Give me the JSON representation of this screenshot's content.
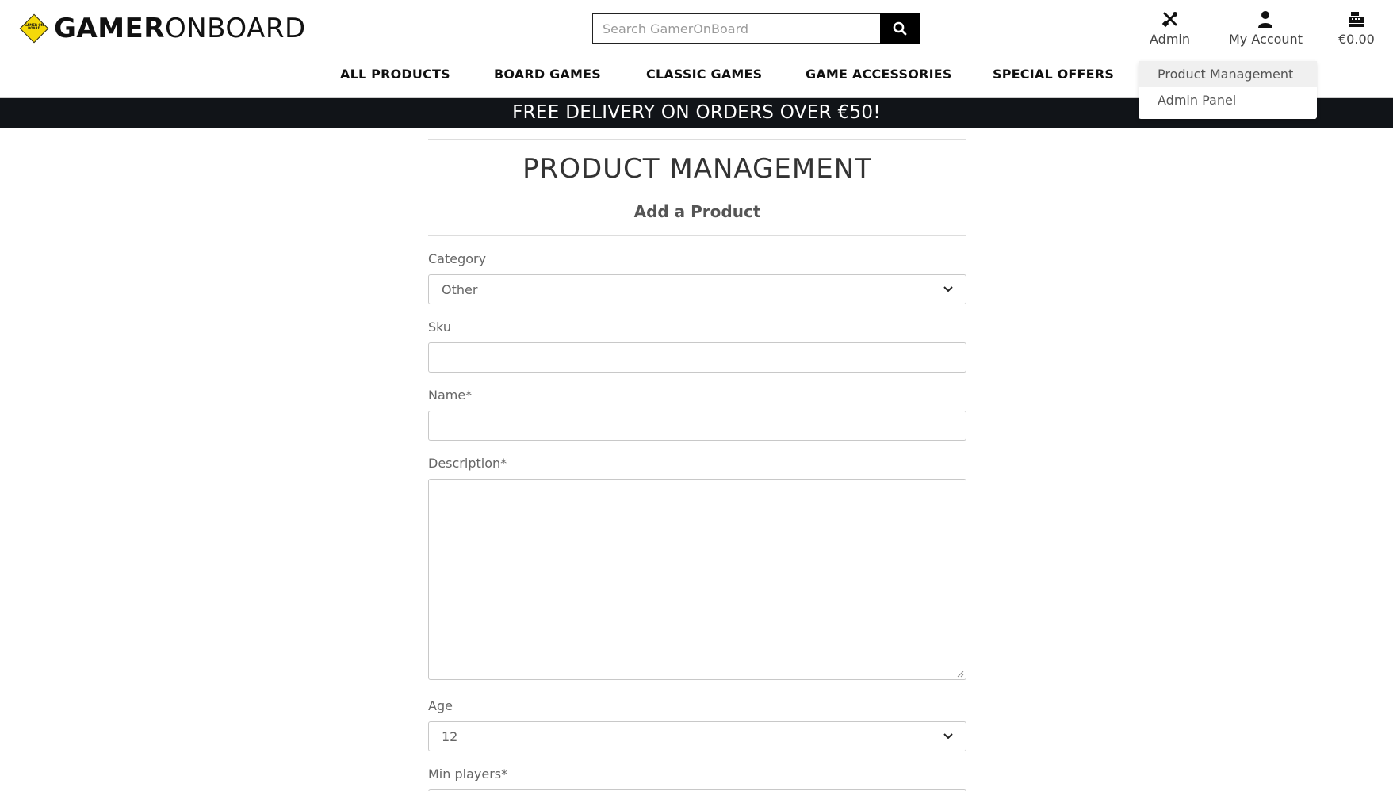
{
  "header": {
    "logo": {
      "badge_text": "GAMER ON BOARD",
      "brand_bold": "GAMER",
      "brand_light": "ONBOARD"
    },
    "search": {
      "placeholder": "Search GamerOnBoard",
      "icon": "search-icon"
    },
    "icons": {
      "admin": {
        "label": "Admin",
        "icon": "tools-icon"
      },
      "account": {
        "label": "My Account",
        "icon": "user-icon"
      },
      "bag": {
        "label": "€0.00",
        "icon": "cash-register-icon"
      }
    }
  },
  "nav": {
    "items": [
      {
        "label": "ALL PRODUCTS"
      },
      {
        "label": "BOARD GAMES"
      },
      {
        "label": "CLASSIC GAMES"
      },
      {
        "label": "GAME ACCESSORIES"
      },
      {
        "label": "SPECIAL OFFERS"
      }
    ]
  },
  "dropdown": {
    "items": [
      {
        "label": "Product Management",
        "active": true
      },
      {
        "label": "Admin Panel",
        "active": false
      }
    ]
  },
  "banner": {
    "text": "FREE DELIVERY ON ORDERS OVER €50!"
  },
  "main": {
    "title": "PRODUCT MANAGEMENT",
    "subtitle": "Add a Product",
    "form": {
      "category": {
        "label": "Category",
        "value": "Other"
      },
      "sku": {
        "label": "Sku",
        "value": ""
      },
      "name": {
        "label": "Name*",
        "value": ""
      },
      "description": {
        "label": "Description*",
        "value": ""
      },
      "age": {
        "label": "Age",
        "value": "12"
      },
      "min_players": {
        "label": "Min players*"
      }
    }
  },
  "colors": {
    "banner_bg": "#111418",
    "logo_yellow": "#f5d90a",
    "button_bg": "#000000"
  }
}
